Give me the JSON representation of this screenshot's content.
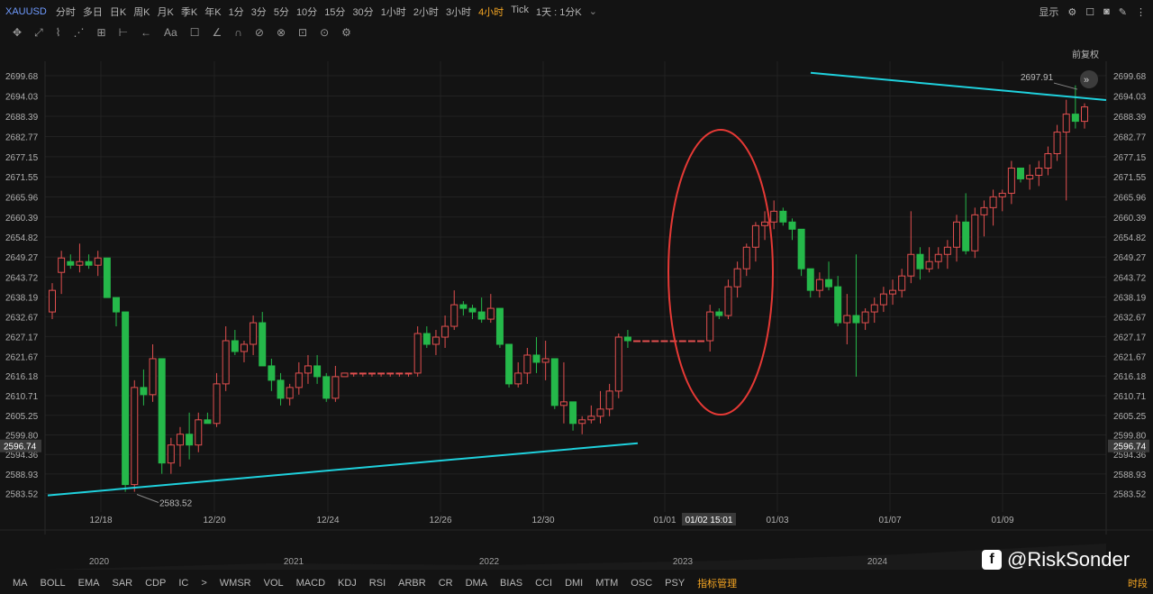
{
  "toolbar": {
    "symbol": "XAUUSD",
    "timeframes": [
      "分时",
      "多日",
      "日K",
      "周K",
      "月K",
      "季K",
      "年K",
      "1分",
      "3分",
      "5分",
      "10分",
      "15分",
      "30分",
      "1小时",
      "2小时",
      "3小时",
      "4小时",
      "Tick"
    ],
    "active_timeframe": "4小时",
    "range_select": "1天 : 1分K",
    "display_label": "显示"
  },
  "drawing_tools": [
    "✥",
    "⤢",
    "⌇",
    "⋰",
    "⊞",
    "⊢",
    "←",
    "Aa",
    "☐",
    "∠",
    "∩",
    "⊘",
    "⊗",
    "⊡",
    "⊙",
    "⚙"
  ],
  "price_adjust_label": "前复权",
  "chart_data": {
    "type": "candlestick",
    "y_ticks": [
      "2699.68",
      "2694.03",
      "2688.39",
      "2682.77",
      "2677.15",
      "2671.55",
      "2665.96",
      "2660.39",
      "2654.82",
      "2649.27",
      "2643.72",
      "2638.19",
      "2632.67",
      "2627.17",
      "2621.67",
      "2616.18",
      "2610.71",
      "2605.25",
      "2599.80",
      "2594.36",
      "2588.93",
      "2583.52"
    ],
    "ylim": [
      2580.8,
      2702.0
    ],
    "current_price": "2596.74",
    "high_label": "2697.91",
    "low_label": "2583.52",
    "x_date_labels": [
      "12/18",
      "12/20",
      "12/24",
      "12/26",
      "12/30",
      "01/01",
      "01/03",
      "01/07",
      "01/09"
    ],
    "crosshair_label": "01/02 15:01",
    "year_labels": [
      "2020",
      "2021",
      "2022",
      "2023",
      "2024"
    ],
    "candles": [
      [
        2634,
        2642,
        2632,
        2640
      ],
      [
        2645,
        2651,
        2639,
        2649
      ],
      [
        2648,
        2650,
        2646,
        2647
      ],
      [
        2647,
        2653,
        2645,
        2648
      ],
      [
        2648,
        2650,
        2646,
        2647
      ],
      [
        2647,
        2651,
        2644,
        2649
      ],
      [
        2649,
        2649,
        2638,
        2638
      ],
      [
        2638,
        2638,
        2630,
        2634
      ],
      [
        2634,
        2634,
        2584,
        2586
      ],
      [
        2586,
        2615,
        2584,
        2613
      ],
      [
        2613,
        2618,
        2608,
        2611
      ],
      [
        2611,
        2625,
        2609,
        2621
      ],
      [
        2621,
        2621,
        2589,
        2592
      ],
      [
        2592,
        2599,
        2589,
        2597
      ],
      [
        2597,
        2602,
        2591,
        2600
      ],
      [
        2600,
        2606,
        2593,
        2597
      ],
      [
        2597,
        2606,
        2595,
        2604
      ],
      [
        2604,
        2606,
        2603,
        2603
      ],
      [
        2603,
        2617,
        2602,
        2614
      ],
      [
        2614,
        2630,
        2612,
        2626
      ],
      [
        2626,
        2629,
        2622,
        2623
      ],
      [
        2623,
        2626,
        2620,
        2625
      ],
      [
        2625,
        2633,
        2622,
        2631
      ],
      [
        2631,
        2634,
        2619,
        2619
      ],
      [
        2619,
        2621,
        2612,
        2615
      ],
      [
        2615,
        2617,
        2608,
        2610
      ],
      [
        2610,
        2614,
        2608,
        2613
      ],
      [
        2613,
        2620,
        2611,
        2617
      ],
      [
        2617,
        2622,
        2614,
        2619
      ],
      [
        2619,
        2622,
        2614,
        2616
      ],
      [
        2616,
        2617,
        2609,
        2610
      ],
      [
        2610,
        2619,
        2609,
        2616
      ],
      [
        2616,
        2617,
        2616,
        2617
      ],
      [
        2617,
        2617,
        2616,
        2617
      ],
      [
        2617,
        2617,
        2616,
        2617
      ],
      [
        2617,
        2617,
        2616,
        2617
      ],
      [
        2617,
        2617,
        2616,
        2617
      ],
      [
        2617,
        2617,
        2616,
        2617
      ],
      [
        2617,
        2617,
        2616,
        2617
      ],
      [
        2617,
        2617,
        2616,
        2617
      ],
      [
        2617,
        2630,
        2616,
        2628
      ],
      [
        2628,
        2630,
        2624,
        2625
      ],
      [
        2625,
        2629,
        2622,
        2627
      ],
      [
        2627,
        2633,
        2624,
        2630
      ],
      [
        2630,
        2640,
        2629,
        2636
      ],
      [
        2636,
        2637,
        2633,
        2635
      ],
      [
        2635,
        2636,
        2632,
        2634
      ],
      [
        2634,
        2638,
        2631,
        2632
      ],
      [
        2632,
        2639,
        2631,
        2635
      ],
      [
        2635,
        2635,
        2624,
        2625
      ],
      [
        2625,
        2625,
        2613,
        2614
      ],
      [
        2614,
        2620,
        2613,
        2617
      ],
      [
        2617,
        2624,
        2614,
        2622
      ],
      [
        2622,
        2627,
        2617,
        2620
      ],
      [
        2620,
        2626,
        2615,
        2621
      ],
      [
        2621,
        2621,
        2607,
        2608
      ],
      [
        2608,
        2620,
        2603,
        2609
      ],
      [
        2609,
        2609,
        2601,
        2603
      ],
      [
        2603,
        2605,
        2600,
        2604
      ],
      [
        2604,
        2608,
        2603,
        2605
      ],
      [
        2605,
        2612,
        2603,
        2607
      ],
      [
        2607,
        2614,
        2605,
        2612
      ],
      [
        2612,
        2628,
        2610,
        2627
      ],
      [
        2627,
        2629,
        2624,
        2626
      ],
      [
        2626,
        2626,
        2626,
        2626
      ],
      [
        2626,
        2626,
        2626,
        2626
      ],
      [
        2626,
        2626,
        2626,
        2626
      ],
      [
        2626,
        2626,
        2626,
        2626
      ],
      [
        2626,
        2626,
        2626,
        2626
      ],
      [
        2626,
        2626,
        2626,
        2626
      ],
      [
        2626,
        2626,
        2626,
        2626
      ],
      [
        2626,
        2626,
        2626,
        2626
      ],
      [
        2626,
        2636,
        2623,
        2634
      ],
      [
        2634,
        2635,
        2632,
        2633
      ],
      [
        2633,
        2643,
        2632,
        2641
      ],
      [
        2641,
        2648,
        2638,
        2646
      ],
      [
        2646,
        2653,
        2644,
        2652
      ],
      [
        2652,
        2659,
        2648,
        2658
      ],
      [
        2658,
        2662,
        2654,
        2659
      ],
      [
        2659,
        2665,
        2657,
        2662
      ],
      [
        2662,
        2663,
        2658,
        2659
      ],
      [
        2659,
        2660,
        2654,
        2657
      ],
      [
        2657,
        2657,
        2644,
        2646
      ],
      [
        2646,
        2646,
        2638,
        2640
      ],
      [
        2640,
        2645,
        2638,
        2643
      ],
      [
        2643,
        2648,
        2640,
        2641
      ],
      [
        2641,
        2644,
        2630,
        2631
      ],
      [
        2631,
        2639,
        2625,
        2633
      ],
      [
        2633,
        2650,
        2616,
        2631
      ],
      [
        2631,
        2635,
        2629,
        2634
      ],
      [
        2634,
        2638,
        2631,
        2636
      ],
      [
        2636,
        2641,
        2634,
        2639
      ],
      [
        2639,
        2643,
        2636,
        2640
      ],
      [
        2640,
        2646,
        2638,
        2644
      ],
      [
        2644,
        2662,
        2642,
        2650
      ],
      [
        2650,
        2652,
        2643,
        2646
      ],
      [
        2646,
        2652,
        2645,
        2648
      ],
      [
        2648,
        2652,
        2646,
        2650
      ],
      [
        2650,
        2654,
        2646,
        2652
      ],
      [
        2652,
        2661,
        2648,
        2659
      ],
      [
        2659,
        2667,
        2650,
        2651
      ],
      [
        2651,
        2663,
        2649,
        2661
      ],
      [
        2661,
        2665,
        2655,
        2663
      ],
      [
        2663,
        2668,
        2658,
        2666
      ],
      [
        2666,
        2668,
        2662,
        2667
      ],
      [
        2667,
        2676,
        2664,
        2674
      ],
      [
        2674,
        2674,
        2670,
        2671
      ],
      [
        2671,
        2675,
        2668,
        2672
      ],
      [
        2672,
        2676,
        2669,
        2674
      ],
      [
        2674,
        2680,
        2672,
        2678
      ],
      [
        2678,
        2686,
        2676,
        2684
      ],
      [
        2684,
        2693,
        2665,
        2689
      ],
      [
        2689,
        2697,
        2685,
        2687
      ],
      [
        2687,
        2692,
        2685,
        2691
      ]
    ],
    "trendlines": [
      {
        "name": "support",
        "from": {
          "x": "12/17",
          "y": 2583.0
        },
        "to": {
          "x": "01/01",
          "y": 2597.5
        }
      },
      {
        "name": "resistance",
        "from": {
          "x": "01/02",
          "y": 2700.5
        },
        "to": {
          "x": "01/10",
          "y": 2692.9
        }
      }
    ],
    "annotation": "red ellipse marking breakout around 01/02",
    "colors": {
      "up": "#e24f4f",
      "down": "#25b84a",
      "trend": "#1fd1dd",
      "annot": "#e53935",
      "grid": "#222222",
      "bg": "#131313"
    }
  },
  "indicators": [
    "MA",
    "BOLL",
    "EMA",
    "SAR",
    "CDP",
    "IC",
    ">",
    "WMSR",
    "VOL",
    "MACD",
    "KDJ",
    "RSI",
    "ARBR",
    "CR",
    "DMA",
    "BIAS",
    "CCI",
    "DMI",
    "MTM",
    "OSC",
    "PSY"
  ],
  "indicator_manager": "指标管理",
  "session_label": "时段",
  "watermark": "@RiskSonder"
}
